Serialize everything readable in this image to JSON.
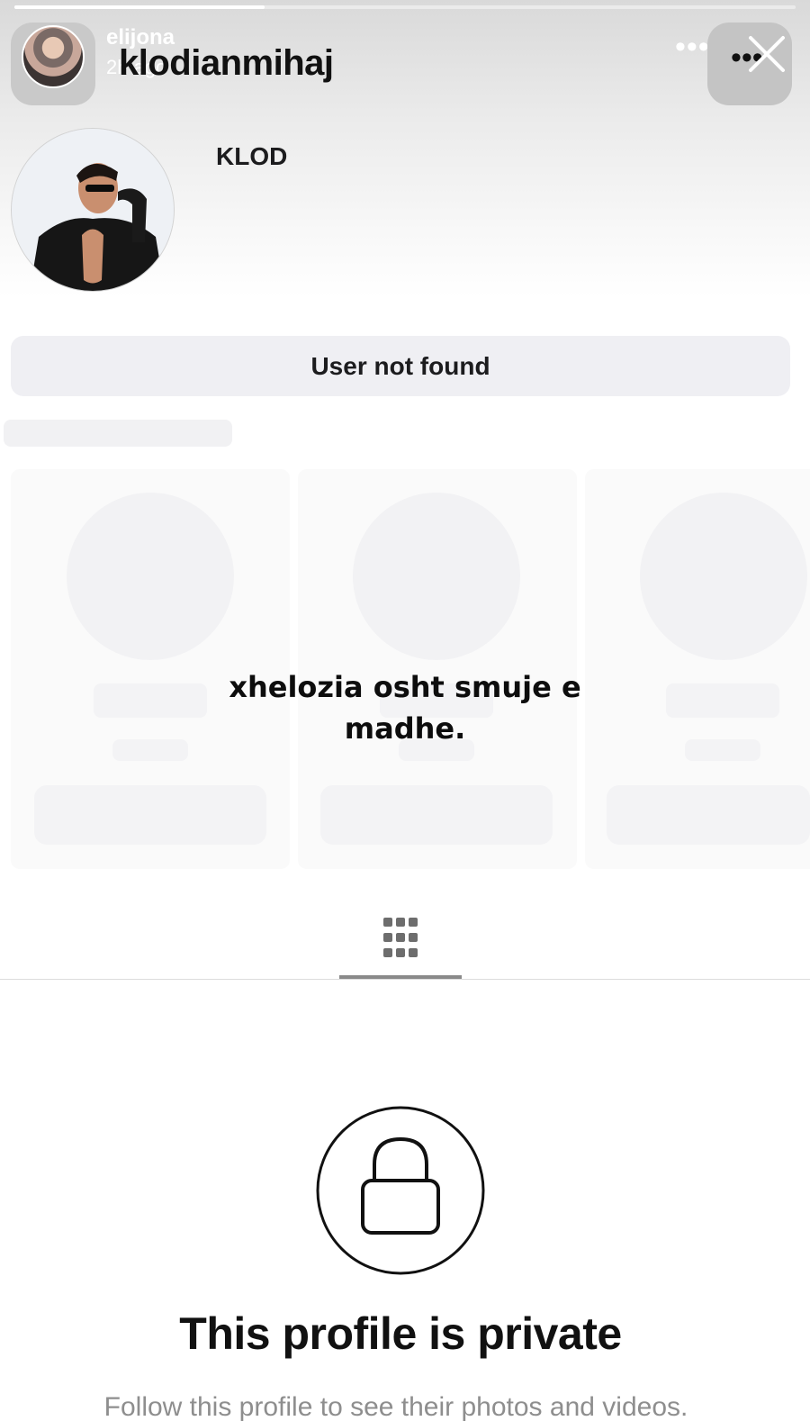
{
  "story": {
    "username": "elijona",
    "time_ago": "2h ago",
    "progress": 0.32,
    "more_icon": "ellipsis-icon",
    "close_icon": "close-icon"
  },
  "profile": {
    "handle": "klodianmihaj",
    "display_name": "KLOD",
    "status_button": "User not found",
    "menu_icon": "ellipsis-icon"
  },
  "caption": {
    "line1": "xhelozia osht smuje e",
    "line2": "madhe."
  },
  "tabs": {
    "grid_icon": "grid-icon"
  },
  "private": {
    "lock_icon": "lock-icon",
    "title": "This profile is private",
    "subtitle": "Follow this profile to see their photos and videos."
  },
  "colors": {
    "button_bg": "#efeff3",
    "skeleton": "#f2f2f4",
    "subtitle": "#8e8e8e"
  }
}
